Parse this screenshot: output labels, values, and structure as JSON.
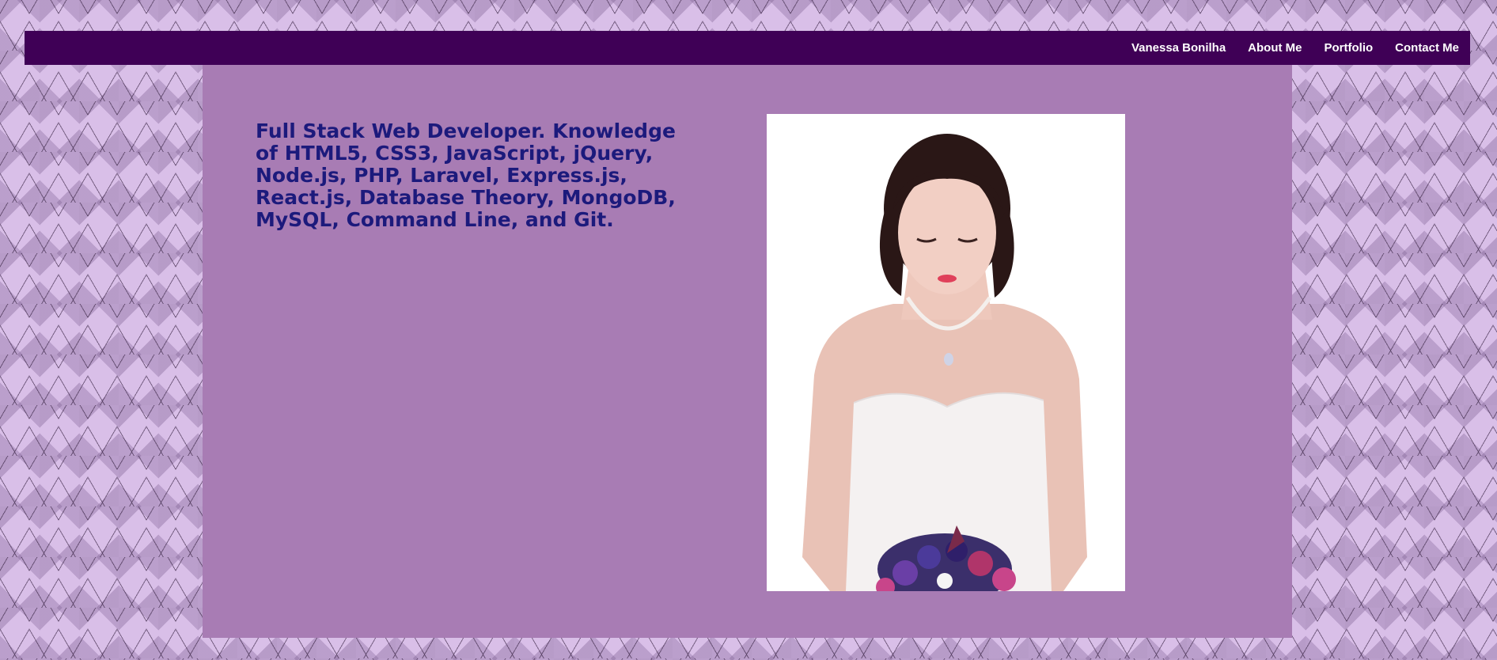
{
  "nav": {
    "links": [
      "Vanessa Bonilha",
      "About Me",
      "Portfolio",
      "Contact Me"
    ]
  },
  "main": {
    "intro": "Full Stack Web Developer. Knowledge of HTML5, CSS3, JavaScript, jQuery, Node.js, PHP, Laravel, Express.js, React.js, Database Theory, MongoDB, MySQL, Command Line, and Git."
  },
  "colors": {
    "nav_bg": "#3f0056",
    "panel_bg": "#a87cb4",
    "intro_text": "#1c1a7c",
    "page_bg": "#d9bfe8"
  }
}
